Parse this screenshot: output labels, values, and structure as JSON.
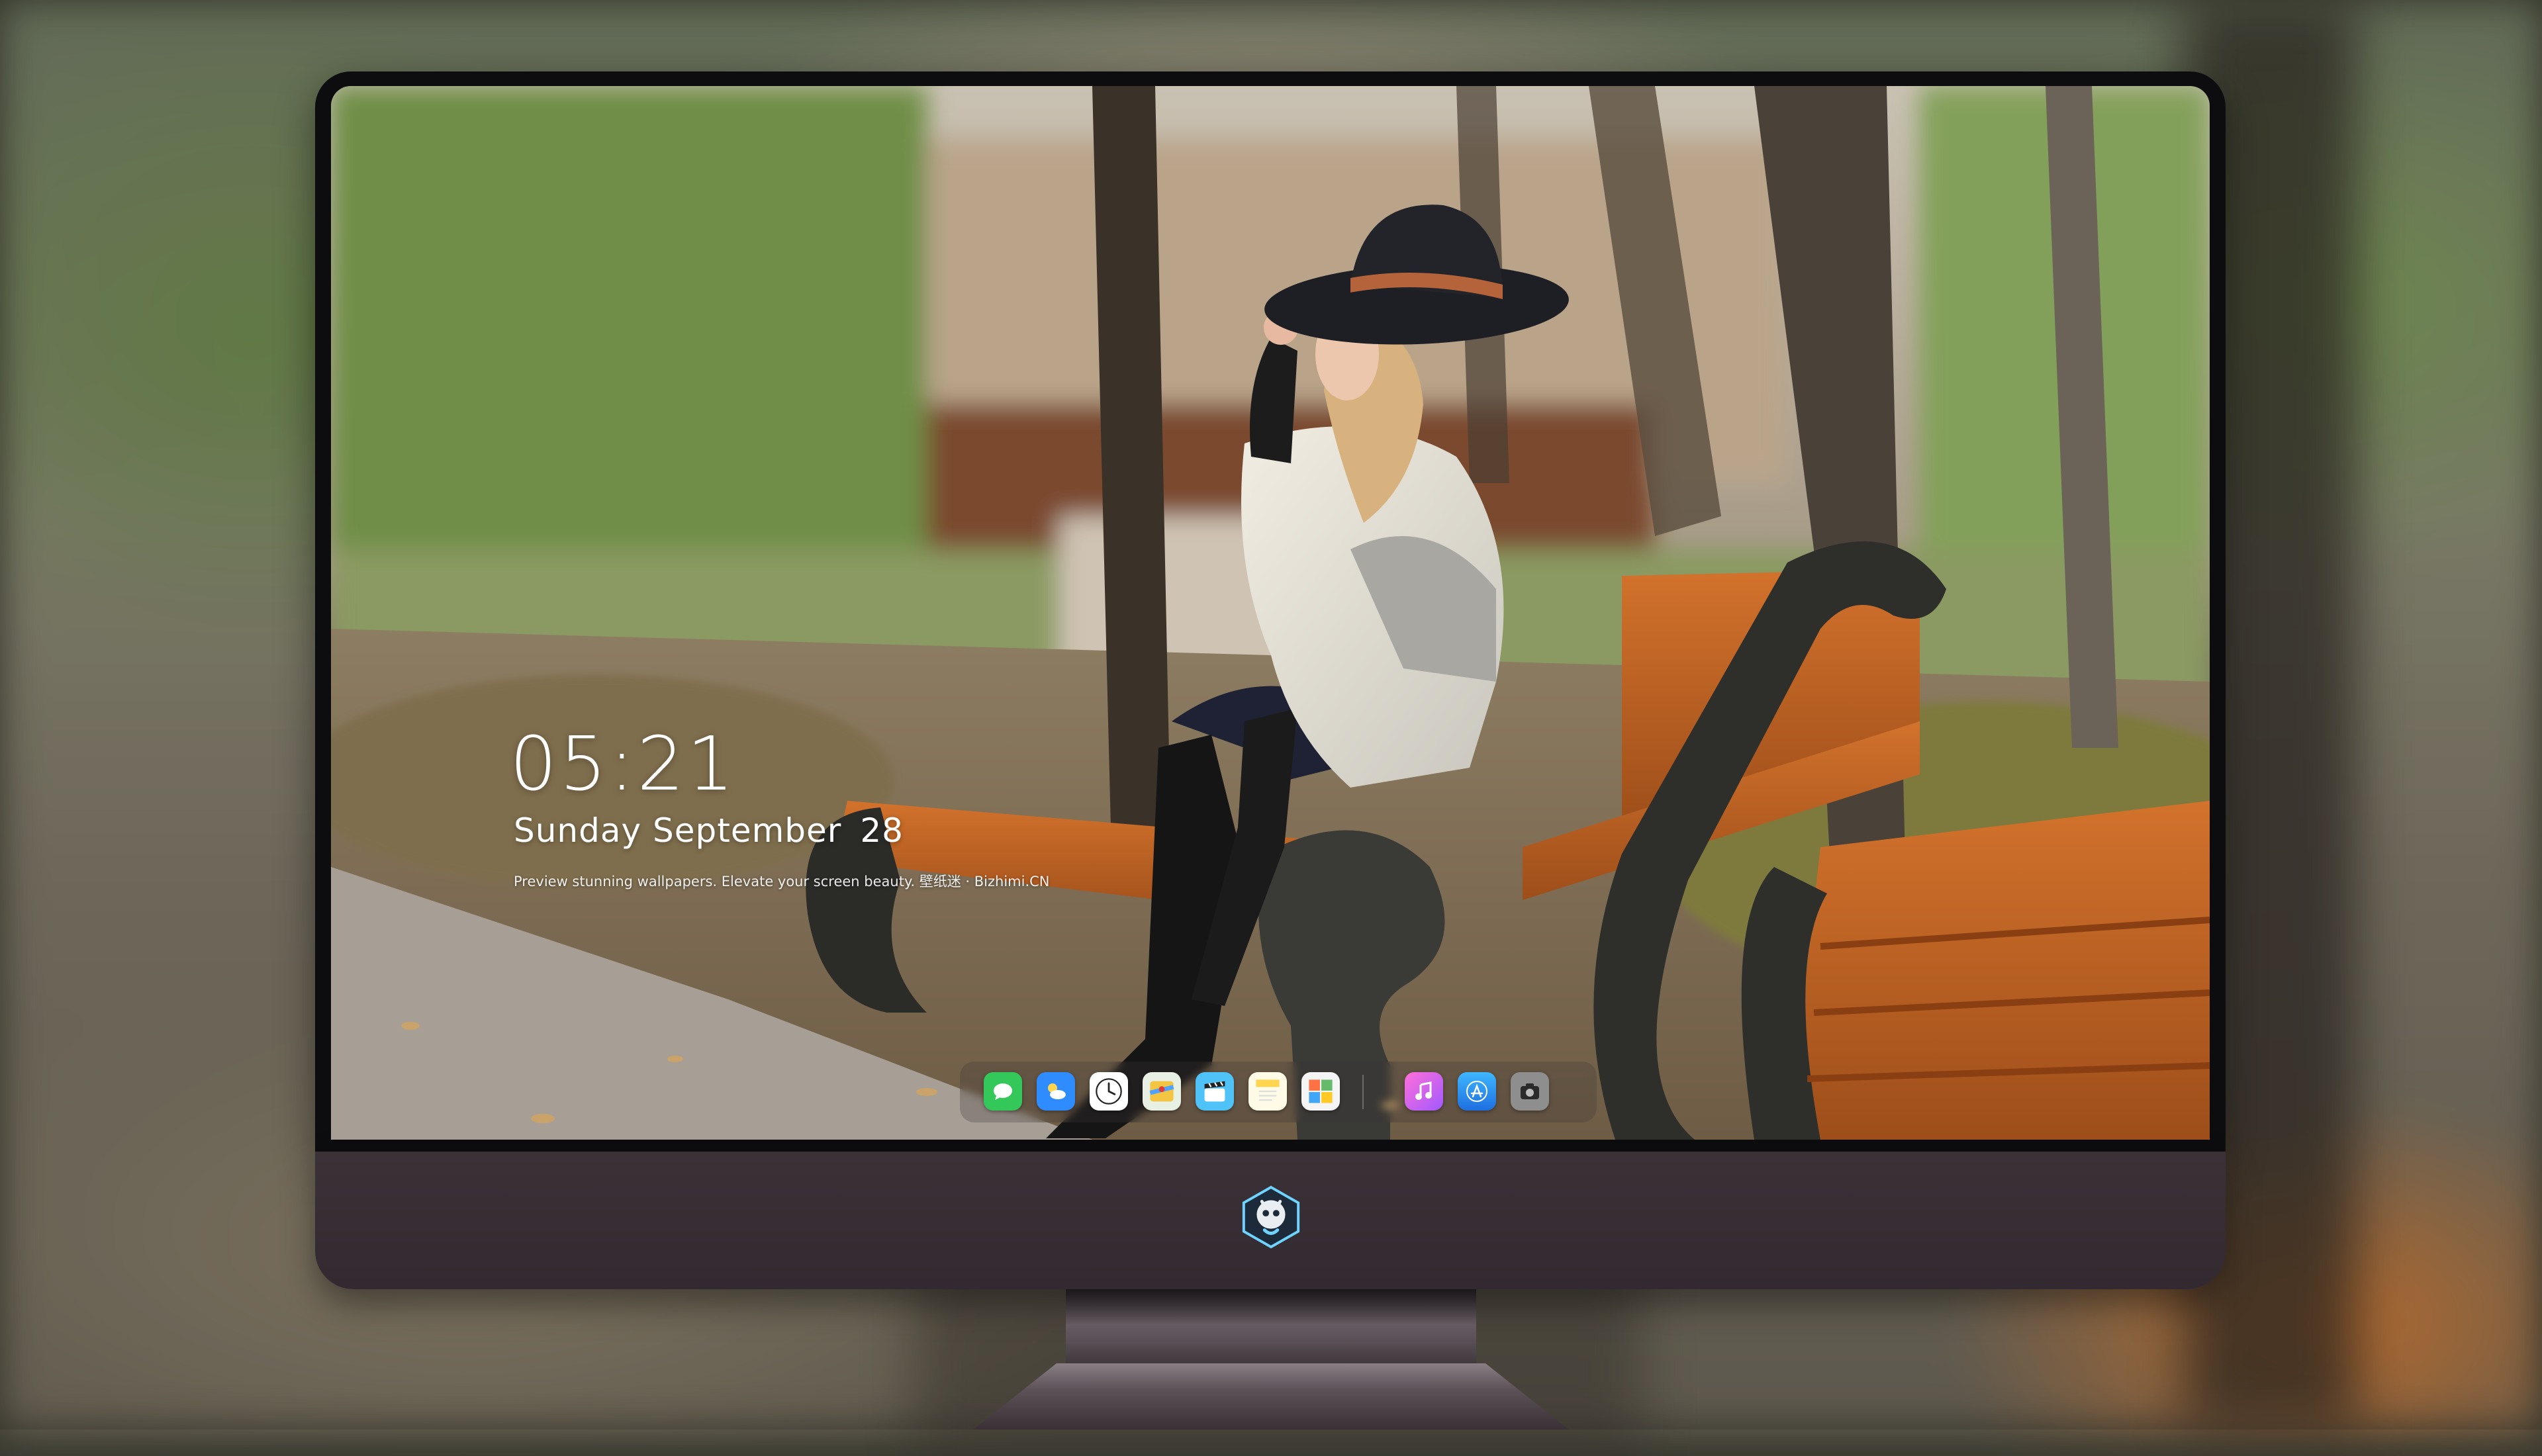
{
  "lock_screen": {
    "time": "05:21",
    "weekday_month": "Sunday September",
    "day": "28",
    "tagline": "Preview stunning wallpapers. Elevate your screen beauty. 壁纸迷 · Bizhimi.CN"
  },
  "dock": {
    "apps": [
      {
        "name": "messages-icon",
        "color": "#34c759"
      },
      {
        "name": "weather-icon",
        "color": "#2f8cff"
      },
      {
        "name": "clock-icon",
        "color": "#ffffff"
      },
      {
        "name": "maps-icon",
        "color": "#f4c542"
      },
      {
        "name": "video-editor-icon",
        "color": "#4fc3f7"
      },
      {
        "name": "notes-icon",
        "color": "#ffd54f"
      },
      {
        "name": "photo-grid-icon",
        "color": "#ff7043"
      },
      {
        "name": "music-icon",
        "color": "#e040fb"
      },
      {
        "name": "app-store-icon",
        "color": "#1e88e5"
      },
      {
        "name": "camera-icon",
        "color": "#9e9e9e"
      }
    ]
  },
  "monitor": {
    "chin_logo": "mascot-logo-icon",
    "bezel_color": "#0d0d10",
    "chin_color": "#362d33"
  }
}
